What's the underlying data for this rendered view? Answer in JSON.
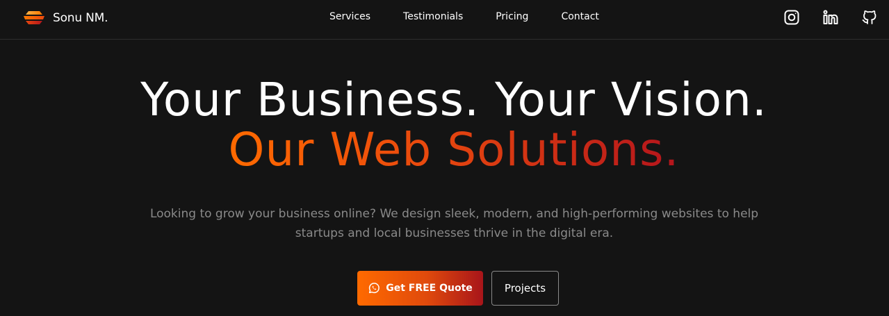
{
  "header": {
    "brand_name": "Sonu NM.",
    "nav": [
      {
        "label": "Services"
      },
      {
        "label": "Testimonials"
      },
      {
        "label": "Pricing"
      },
      {
        "label": "Contact"
      }
    ],
    "socials": [
      {
        "icon": "instagram-icon"
      },
      {
        "icon": "linkedin-icon"
      },
      {
        "icon": "github-icon"
      }
    ]
  },
  "hero": {
    "headline_line1": "Your Business. Your Vision.",
    "headline_line2": "Our Web Solutions.",
    "subtitle": "Looking to grow your business online? We design sleek, modern, and high-performing websites to help startups and local businesses thrive in the digital era.",
    "primary_cta_label": "Get FREE Quote",
    "primary_cta_icon": "whatsapp-icon",
    "secondary_cta_label": "Projects"
  },
  "colors": {
    "background": "#141414",
    "accent_start": "#ff6a00",
    "accent_end": "#b3141c",
    "muted_text": "#8a8a8a"
  }
}
